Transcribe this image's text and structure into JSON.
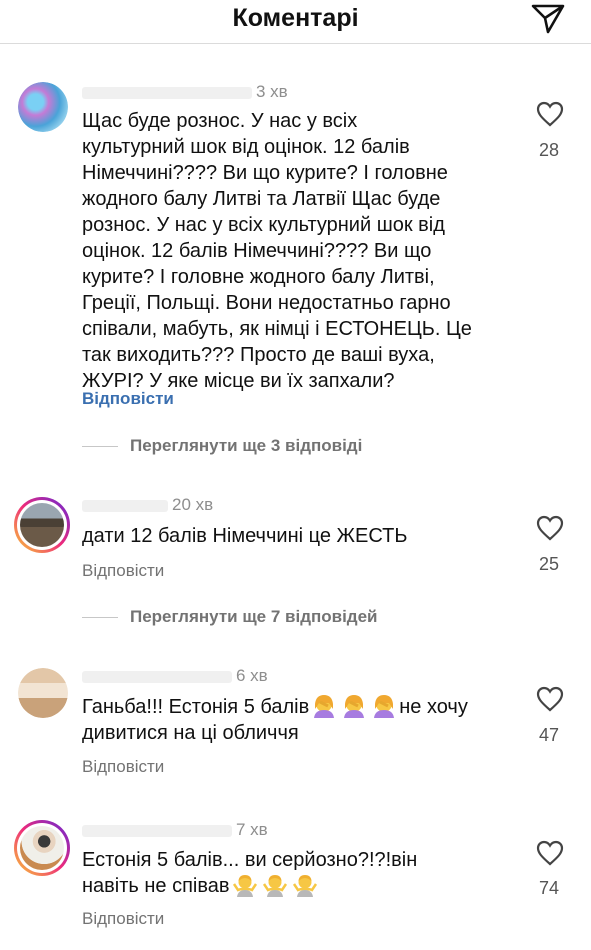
{
  "header": {
    "title": "Коментарі",
    "share_icon": "send-icon"
  },
  "comments": [
    {
      "time": "3 хв",
      "text": "Щас буде рознос. У нас у всіх\nкультурний шок від оцінок. 12 балів\nНімеччині???? Ви що курите? І головне\nжодного балу Литві та Латвії Щас буде\nрознос. У нас у всіх культурний шок від\nоцінок. 12 балів Німеччині???? Ви що\nкурите? І головне жодного балу Литві,\nГреції, Польщі. Вони недостатньо гарно\nспівали, мабуть, як німці і ЕСТОНЕЦЬ. Це\nтак виходить??? Просто де ваші вуха,\nЖУРІ? У яке місце ви їх запхали?",
      "reply": "Відповісти",
      "likes": "28",
      "view_replies": "Переглянути ще 3 відповіді"
    },
    {
      "time": "20 хв",
      "text": "дати 12 балів Німеччині це ЖЕСТЬ",
      "reply": "Відповісти",
      "likes": "25",
      "view_replies": "Переглянути ще 7 відповідей"
    },
    {
      "time": "6 хв",
      "text_before": "Ганьба!!! Естонія 5 балів",
      "text_after": "не хочу",
      "text_line2": "дивитися на ці обличчя",
      "emoji": "woman-facepalming",
      "reply": "Відповісти",
      "likes": "47"
    },
    {
      "time": "7 хв",
      "text_line1": "Естонія 5 балів... ви серйозно?!?!він",
      "text_line2": "навіть не співав",
      "emoji": "man-shrugging",
      "reply": "Відповісти",
      "likes": "74"
    }
  ],
  "colors": {
    "reply_blue": "#3a6fb0",
    "muted": "#8e8e8e",
    "ring_start": "#f9ce34",
    "ring_end": "#6228d7"
  }
}
